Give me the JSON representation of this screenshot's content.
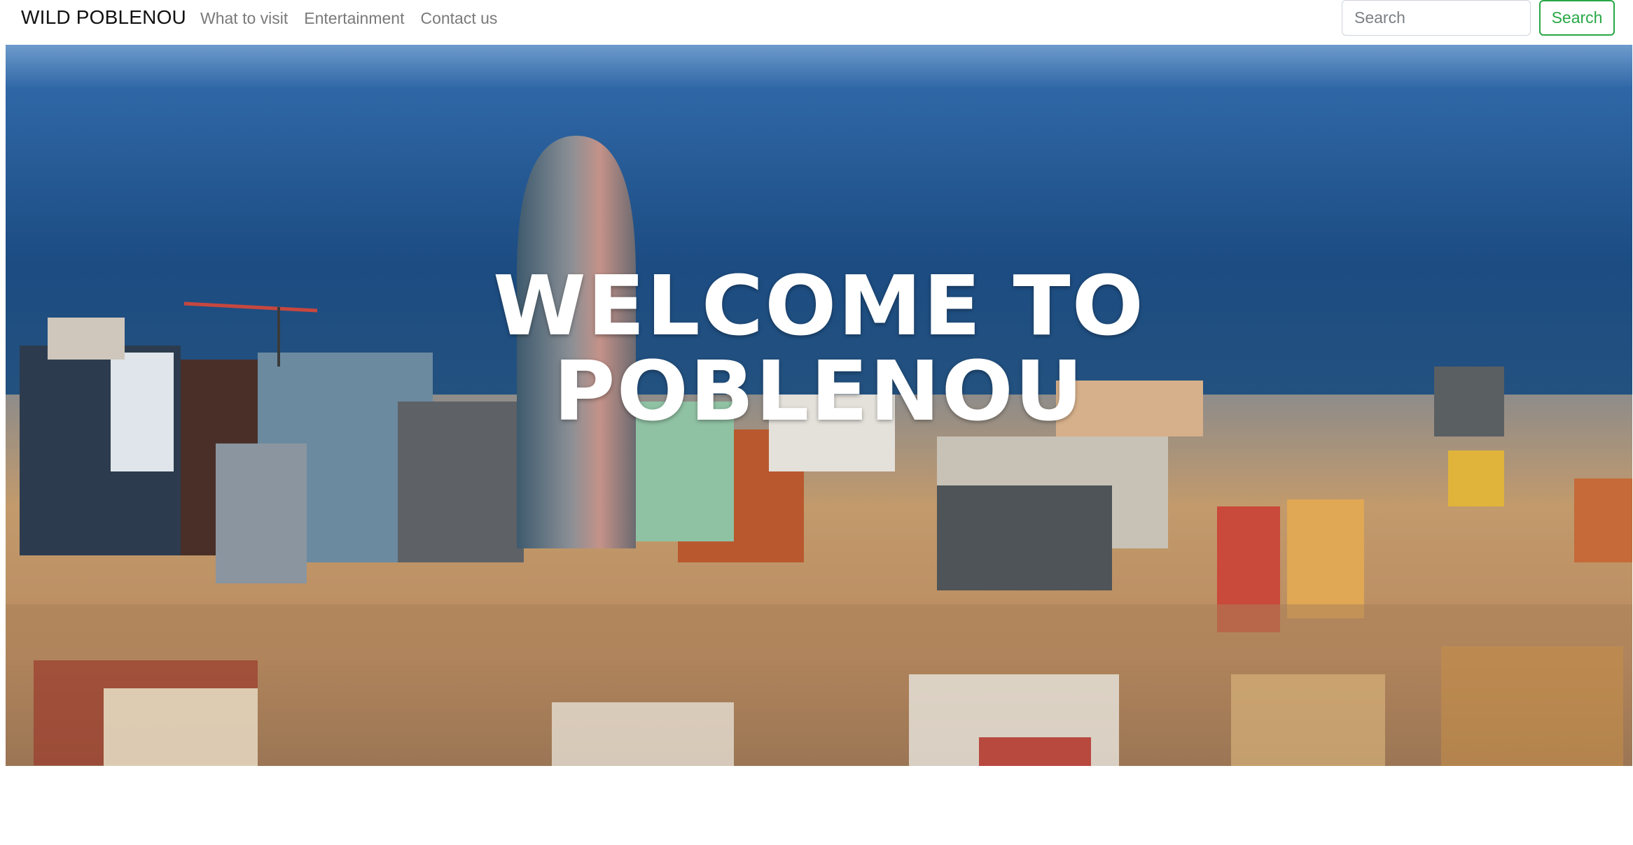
{
  "navbar": {
    "brand": "WILD POBLENOU",
    "links": [
      {
        "label": "What to visit"
      },
      {
        "label": "Entertainment"
      },
      {
        "label": "Contact us"
      }
    ],
    "search": {
      "placeholder": "Search",
      "value": "",
      "button_label": "Search"
    },
    "colors": {
      "link": "#7a7a7a",
      "search_button": "#28a745"
    }
  },
  "hero": {
    "title_line1": "WELCOME TO",
    "title_line2": "POBLENOU",
    "image_subject": "Aerial view of Barcelona city skyline with the sea and Torre Glòries tower"
  }
}
